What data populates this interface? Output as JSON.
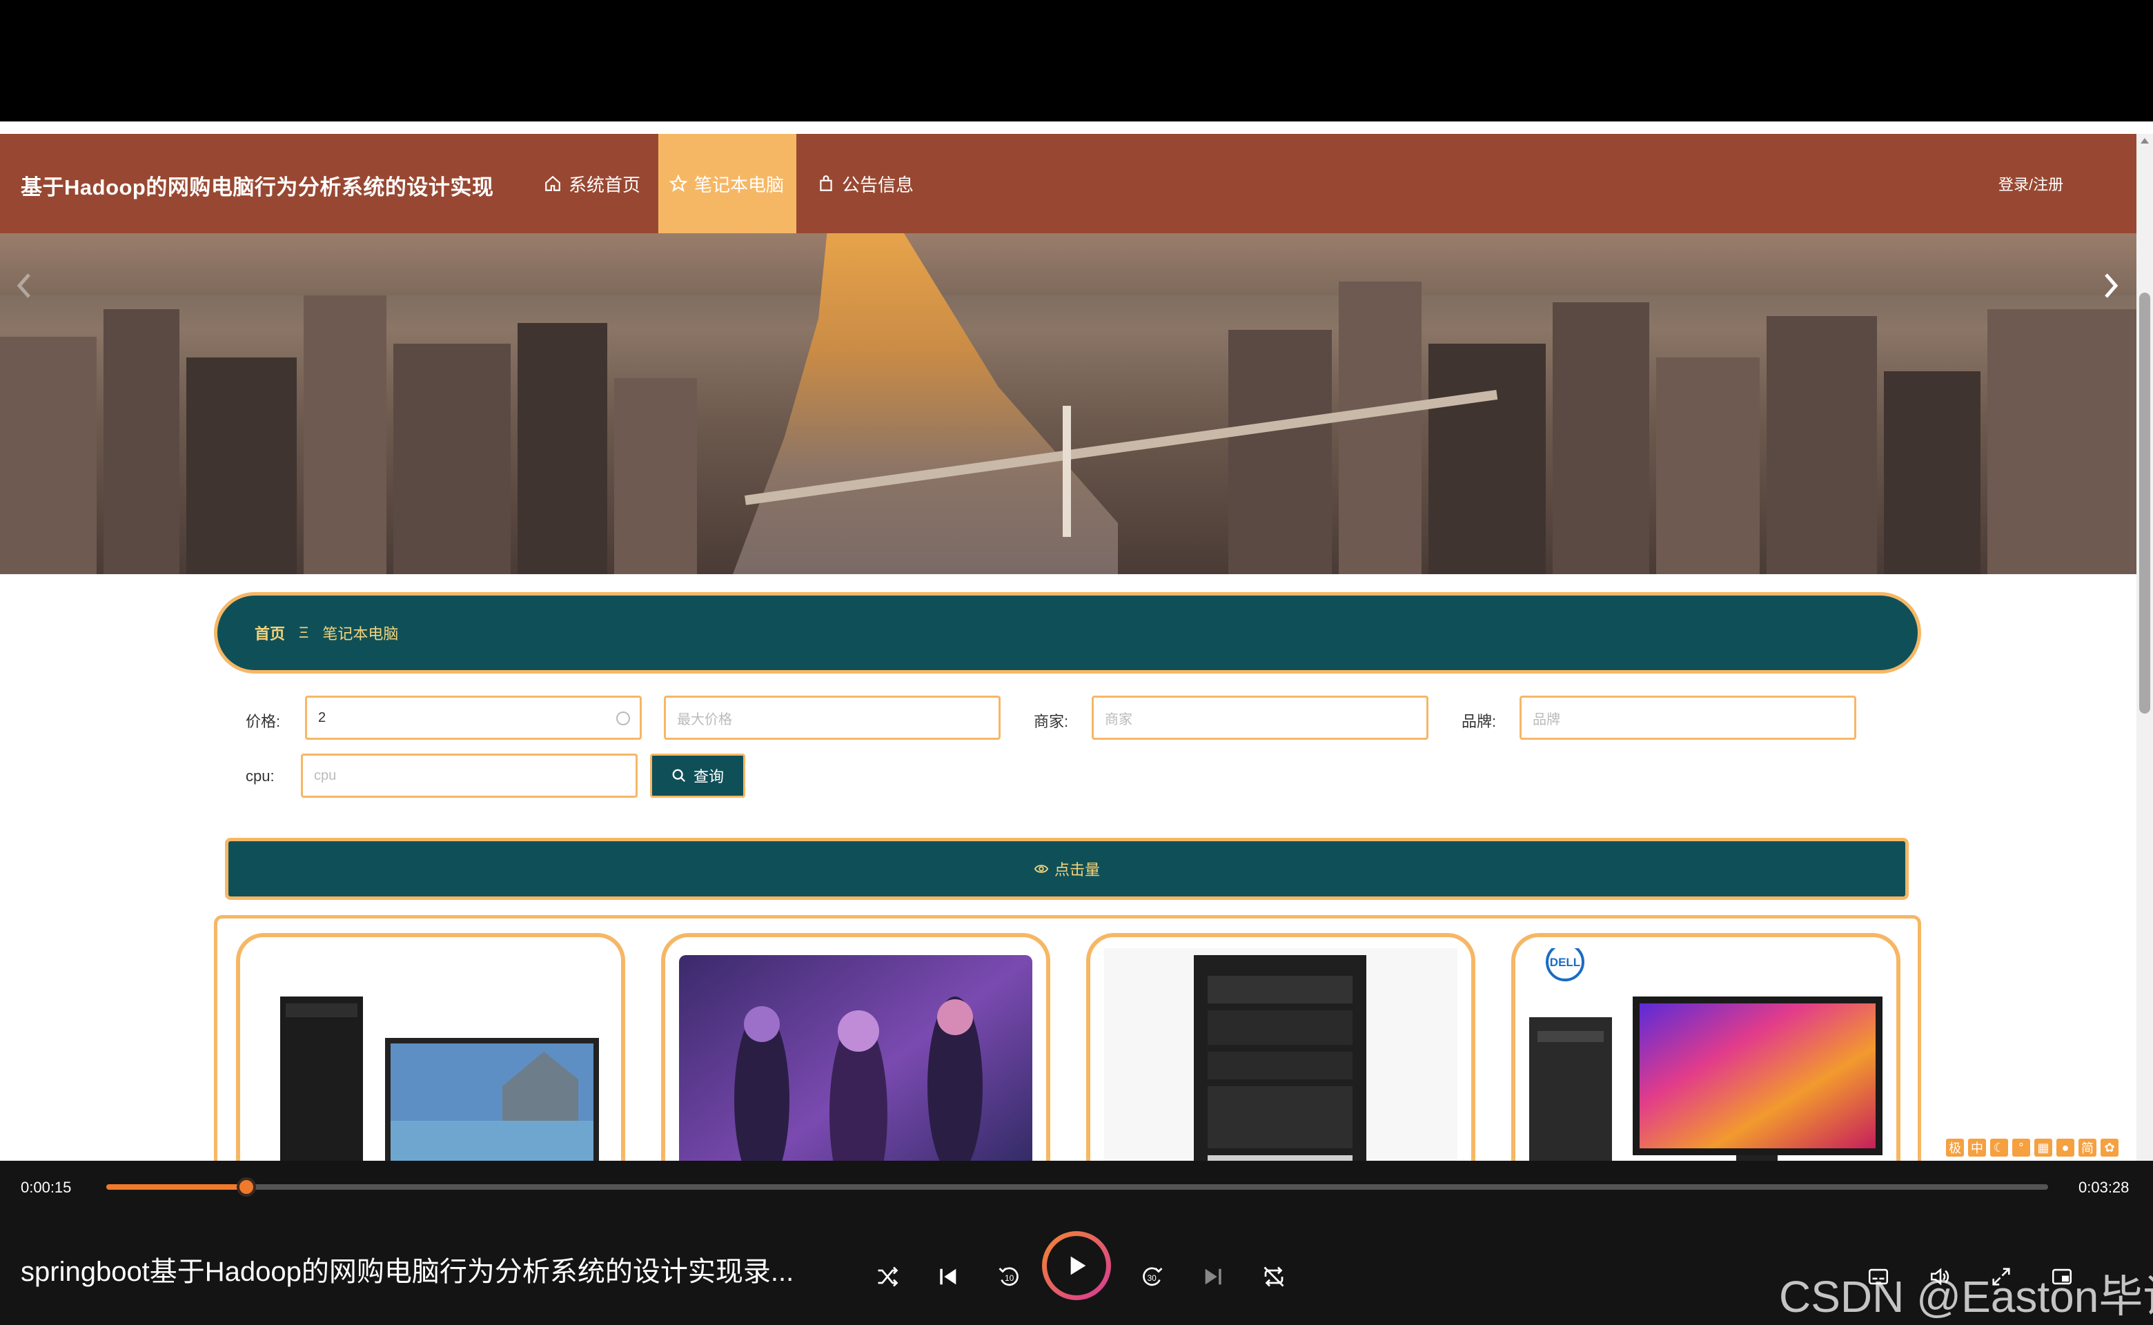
{
  "site": {
    "title": "基于Hadoop的网购电脑行为分析系统的设计实现",
    "nav": [
      {
        "label": "系统首页",
        "icon": "home-icon",
        "active": false
      },
      {
        "label": "笔记本电脑",
        "icon": "star-icon",
        "active": true
      },
      {
        "label": "公告信息",
        "icon": "bag-icon",
        "active": false
      }
    ],
    "login": "登录/注册",
    "colors": {
      "header": "#984832",
      "accent": "#f6b765",
      "teal": "#0f5058"
    }
  },
  "breadcrumb": {
    "home": "首页",
    "separator": "Ξ",
    "current": "笔记本电脑"
  },
  "search": {
    "price_label": "价格:",
    "price_value": "2",
    "max_price_placeholder": "最大价格",
    "merchant_label": "商家:",
    "merchant_placeholder": "商家",
    "brand_label": "品牌:",
    "brand_placeholder": "品牌",
    "cpu_label": "cpu:",
    "cpu_placeholder": "cpu",
    "button_label": "查询"
  },
  "sort": {
    "label": "点击量",
    "icon": "eye-icon"
  },
  "products": [
    {
      "image": "desktop-tower-and-laptop"
    },
    {
      "image": "game-artwork"
    },
    {
      "image": "desktop-tower"
    },
    {
      "image": "dell-desktop-and-monitor",
      "brand_mark": "DELL"
    }
  ],
  "player": {
    "time_current": "0:00:15",
    "time_total": "0:03:28",
    "progress": 0.072,
    "title": "springboot基于Hadoop的网购电脑行为分析系统的设计实现录...",
    "watermark": "CSDN @Easton毕设"
  },
  "ime": [
    "极",
    "中",
    "简"
  ]
}
